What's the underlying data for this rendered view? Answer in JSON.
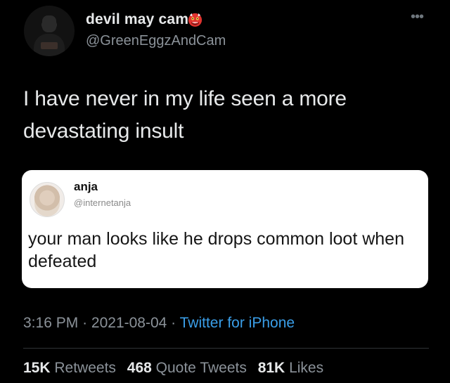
{
  "tweet": {
    "author": {
      "display_name": "devil may cam",
      "handle": "@GreenEggzAndCam",
      "name_emoji_icon": "red-ogre-emoji-icon"
    },
    "more_icon": "ellipsis-icon",
    "text": "I have never in my life seen a more devastating insult",
    "quoted": {
      "name": "anja",
      "handle": "@internetanja",
      "text": "your man looks like he drops common loot when defeated"
    },
    "meta": {
      "time": "3:16 PM",
      "date": "2021-08-04",
      "separator": "·",
      "app": "Twitter for iPhone"
    },
    "stats": {
      "retweets_count": "15K",
      "retweets_label": "Retweets",
      "quotes_count": "468",
      "quotes_label": "Quote Tweets",
      "likes_count": "81K",
      "likes_label": "Likes"
    },
    "colors": {
      "background": "#000000",
      "text": "#e7e9ea",
      "muted": "#8b9299",
      "link": "#3a9ee8",
      "card": "#ffffff"
    }
  }
}
